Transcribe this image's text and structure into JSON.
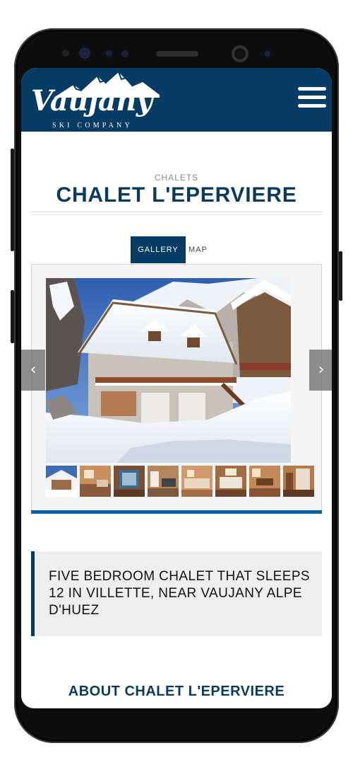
{
  "header": {
    "logo_text": "Vaujany",
    "logo_subtitle": "SKI COMPANY",
    "menu_icon": "hamburger-menu-icon",
    "bg_color": "#063b63"
  },
  "page": {
    "kicker": "CHALETS",
    "title": "CHALET L'EPERVIERE"
  },
  "tabs": [
    {
      "label": "GALLERY",
      "active": true
    },
    {
      "label": "MAP",
      "active": false
    }
  ],
  "gallery": {
    "prev_icon": "chevron-left-icon",
    "next_icon": "chevron-right-icon",
    "prev_glyph": "‹",
    "next_glyph": "›",
    "thumbnail_count": 8,
    "active_thumbnail": 1,
    "accent_color": "#0b5ea8"
  },
  "description": {
    "text": "FIVE BEDROOM CHALET THAT SLEEPS 12 IN VILLETTE, NEAR VAUJANY ALPE D'HUEZ"
  },
  "about_heading": "ABOUT CHALET L'EPERVIERE"
}
